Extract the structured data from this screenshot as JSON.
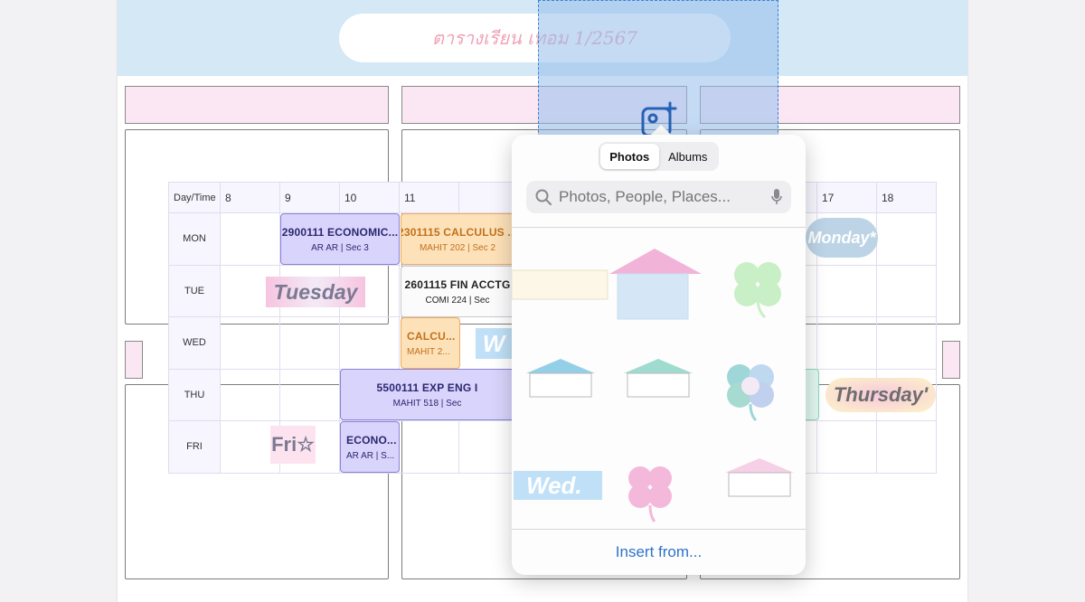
{
  "document": {
    "title": "ตารางเรียน เทอม 1/2567"
  },
  "timetable": {
    "corner_label": "Day/Time",
    "hours": [
      "8",
      "9",
      "10",
      "11",
      "",
      "",
      "",
      "",
      "",
      "",
      "17",
      "18"
    ],
    "days": [
      "MON",
      "TUE",
      "WED",
      "THU",
      "FRI"
    ],
    "events": [
      {
        "title": "2900111 ECONOMIC...",
        "sub": "AR AR | Sec 3",
        "style": "purple"
      },
      {
        "title": "2301115 CALCULUS ...",
        "sub": "MAHIT 202 | Sec 2",
        "style": "orange"
      },
      {
        "title": "2601115 FIN ACCTG",
        "sub": "COMI 224 | Sec",
        "style": "white"
      },
      {
        "title": "CALCU...",
        "sub": "MAHIT 2...",
        "style": "orange"
      },
      {
        "title": "5500111 EXP ENG I",
        "sub": "MAHIT 518 | Sec",
        "style": "purple"
      },
      {
        "title": "ECONO...",
        "sub": "AR AR | S...",
        "style": "purple"
      }
    ],
    "stickers": {
      "monday": "Monday*",
      "tuesday": "Tuesday",
      "wednesday": "W",
      "thursday": "Thursday'",
      "friday": "Fri☆"
    }
  },
  "photo_picker": {
    "tabs": [
      {
        "label": "Photos",
        "selected": true
      },
      {
        "label": "Albums",
        "selected": false
      }
    ],
    "search_placeholder": "Photos, People, Places...",
    "sticker_wed": "Wed.",
    "insert_label": "Insert from...",
    "accent_color": "#2f73c9"
  },
  "icons": {
    "add_photo": "photo-plus-icon",
    "search": "magnifier-icon",
    "mic": "microphone-icon"
  }
}
